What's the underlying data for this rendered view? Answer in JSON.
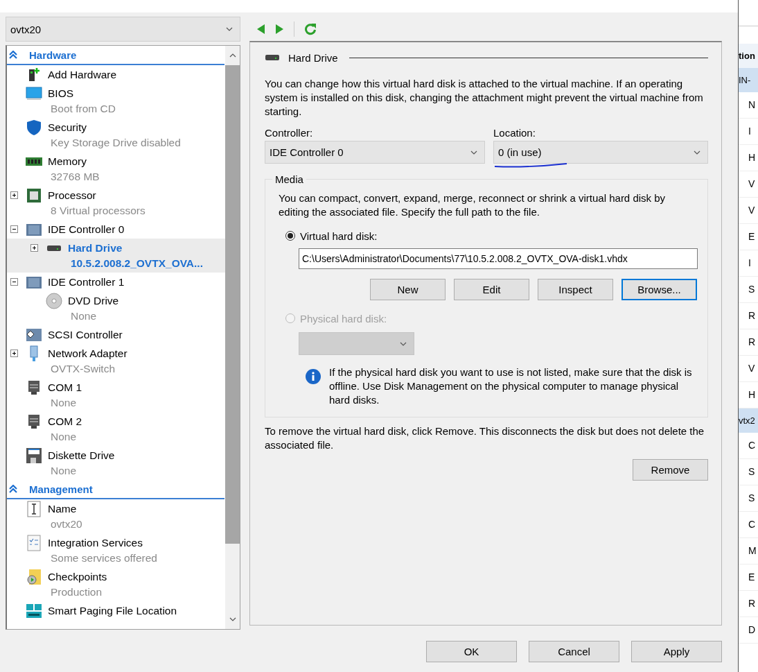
{
  "vm_selector": {
    "value": "ovtx20"
  },
  "sidebar": {
    "sections": [
      {
        "title": "Hardware",
        "expanded": true,
        "items": [
          {
            "kind": "add_hardware",
            "label": "Add Hardware",
            "selected": false
          },
          {
            "kind": "bios",
            "label": "BIOS",
            "detail": "Boot from CD",
            "selected": false
          },
          {
            "kind": "security",
            "label": "Security",
            "detail": "Key Storage Drive disabled",
            "selected": false
          },
          {
            "kind": "memory",
            "label": "Memory",
            "detail": "32768 MB",
            "selected": false
          },
          {
            "kind": "processor",
            "label": "Processor",
            "detail": "8 Virtual processors",
            "expanded": false,
            "selected": false
          },
          {
            "kind": "controller",
            "label": "IDE Controller 0",
            "expanded": true,
            "selected": false,
            "children": [
              {
                "kind": "hard_drive",
                "label": "Hard Drive",
                "detail": "10.5.2.008.2_OVTX_OVA...",
                "expanded": false,
                "selected": true
              }
            ]
          },
          {
            "kind": "controller",
            "label": "IDE Controller 1",
            "expanded": true,
            "selected": false,
            "children": [
              {
                "kind": "dvd",
                "label": "DVD Drive",
                "detail": "None",
                "selected": false
              }
            ]
          },
          {
            "kind": "scsi",
            "label": "SCSI Controller",
            "selected": false
          },
          {
            "kind": "network",
            "label": "Network Adapter",
            "detail": "OVTX-Switch",
            "expanded": false,
            "selected": false
          },
          {
            "kind": "com",
            "label": "COM 1",
            "detail": "None",
            "selected": false
          },
          {
            "kind": "com",
            "label": "COM 2",
            "detail": "None",
            "selected": false
          },
          {
            "kind": "diskette",
            "label": "Diskette Drive",
            "detail": "None",
            "selected": false
          }
        ]
      },
      {
        "title": "Management",
        "expanded": true,
        "items": [
          {
            "kind": "name",
            "label": "Name",
            "detail": "ovtx20",
            "selected": false
          },
          {
            "kind": "integration",
            "label": "Integration Services",
            "detail": "Some services offered",
            "selected": false
          },
          {
            "kind": "checkpoints",
            "label": "Checkpoints",
            "detail": "Production",
            "selected": false
          },
          {
            "kind": "paging",
            "label": "Smart Paging File Location",
            "selected": false
          }
        ]
      }
    ]
  },
  "details": {
    "title": "Hard Drive",
    "description": "You can change how this virtual hard disk is attached to the virtual machine. If an operating system is installed on this disk, changing the attachment might prevent the virtual machine from starting.",
    "controller": {
      "label": "Controller:",
      "value": "IDE Controller 0"
    },
    "location": {
      "label": "Location:",
      "value": "0 (in use)"
    },
    "media": {
      "title": "Media",
      "description": "You can compact, convert, expand, merge, reconnect or shrink a virtual hard disk by editing the associated file. Specify the full path to the file.",
      "options": [
        {
          "label": "Virtual hard disk:",
          "selected": true,
          "disabled": false
        },
        {
          "label": "Physical hard disk:",
          "selected": false,
          "disabled": true
        }
      ],
      "path": "C:\\Users\\Administrator\\Documents\\77\\10.5.2.008.2_OVTX_OVA-disk1.vhdx",
      "buttons": [
        {
          "label": "New",
          "focused": false
        },
        {
          "label": "Edit",
          "focused": false
        },
        {
          "label": "Inspect",
          "focused": false
        },
        {
          "label": "Browse...",
          "focused": true
        }
      ],
      "info": "If the physical hard disk you want to use is not listed, make sure that the disk is offline. Use Disk Management on the physical computer to manage physical hard disks."
    },
    "remove_note": "To remove the virtual hard disk, click Remove. This disconnects the disk but does not delete the associated file.",
    "remove_button": "Remove"
  },
  "footer_buttons": [
    "OK",
    "Cancel",
    "Apply"
  ],
  "background_window": {
    "header": "tion",
    "groups": [
      {
        "title": "IN-",
        "items": [
          "N",
          "I",
          "H",
          "V",
          "V",
          "E",
          "I",
          "S",
          "R",
          "R",
          "V",
          "H"
        ]
      },
      {
        "title": "vtx2",
        "items": [
          "C",
          "S",
          "S",
          "C",
          "M",
          "E",
          "R",
          "D"
        ]
      }
    ]
  }
}
